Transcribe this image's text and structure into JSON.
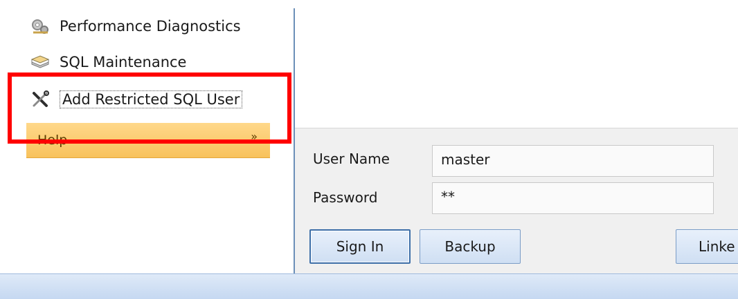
{
  "sidebar": {
    "items": [
      {
        "label": "Performance Diagnostics",
        "icon": "gears-icon"
      },
      {
        "label": "SQL Maintenance",
        "icon": "database-stack-icon"
      },
      {
        "label": "Add Restricted SQL User",
        "icon": "tools-crossed-icon"
      }
    ],
    "help": {
      "label": "Help",
      "chevron": "»"
    }
  },
  "login": {
    "username_label": "User Name",
    "username_value": "master",
    "password_label": "Password",
    "password_value": "**"
  },
  "buttons": {
    "sign_in": "Sign In",
    "backup": "Backup",
    "linked": "Linke"
  },
  "colors": {
    "highlight": "#ff0000",
    "help_header": "#f8c25c",
    "button_border": "#7a9cc6"
  }
}
